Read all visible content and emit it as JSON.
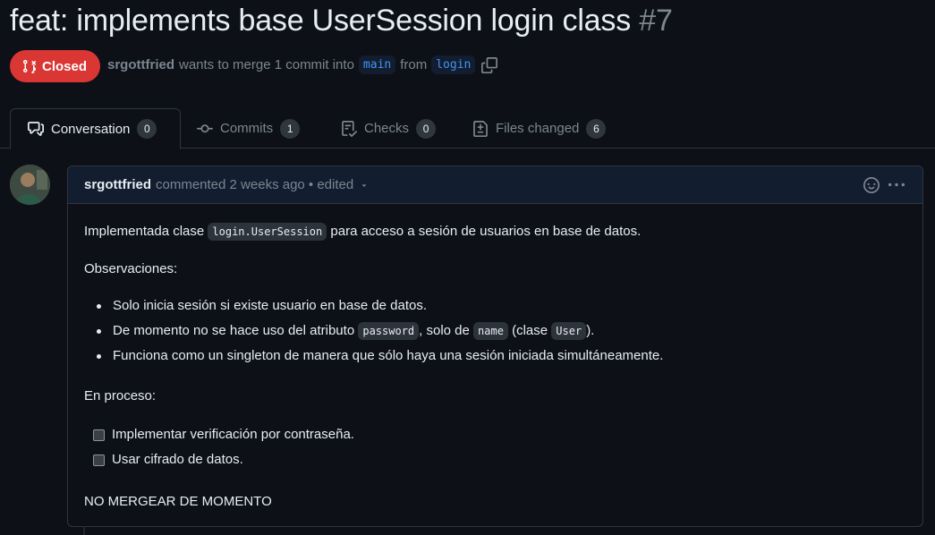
{
  "pr": {
    "title": "feat: implements base UserSession login class",
    "number": "#7",
    "state": "Closed",
    "author": "srgottfried",
    "merge_text": "wants to merge 1 commit into",
    "base_branch": "main",
    "from_text": "from",
    "head_branch": "login"
  },
  "tabs": [
    {
      "label": "Conversation",
      "count": "0",
      "icon": "comment-discussion-icon"
    },
    {
      "label": "Commits",
      "count": "1",
      "icon": "git-commit-icon"
    },
    {
      "label": "Checks",
      "count": "0",
      "icon": "checklist-icon"
    },
    {
      "label": "Files changed",
      "count": "6",
      "icon": "file-diff-icon"
    }
  ],
  "comment": {
    "author": "srgottfried",
    "meta": "commented 2 weeks ago • edited",
    "body": {
      "p1_before": "Implementada clase ",
      "p1_code": "login.UserSession",
      "p1_after": " para acceso a sesión de usuarios en base de datos.",
      "observaciones": "Observaciones:",
      "bullet1": "Solo inicia sesión si existe usuario en base de datos.",
      "bullet2_a": "De momento no se hace uso del atributo ",
      "bullet2_code1": "password",
      "bullet2_b": ", solo de ",
      "bullet2_code2": "name",
      "bullet2_c": " (clase ",
      "bullet2_code3": "User",
      "bullet2_d": ").",
      "bullet3": "Funciona como un singleton de manera que sólo haya una sesión iniciada simultáneamente.",
      "en_proceso": "En proceso:",
      "task1": "Implementar verificación por contraseña.",
      "task2": "Usar cifrado de datos.",
      "footer": "NO MERGEAR DE MOMENTO"
    }
  },
  "colors": {
    "background": "#0d1117",
    "closed_badge": "#da3633",
    "branch_text": "#4493f8",
    "header_bg": "#121d2f"
  }
}
